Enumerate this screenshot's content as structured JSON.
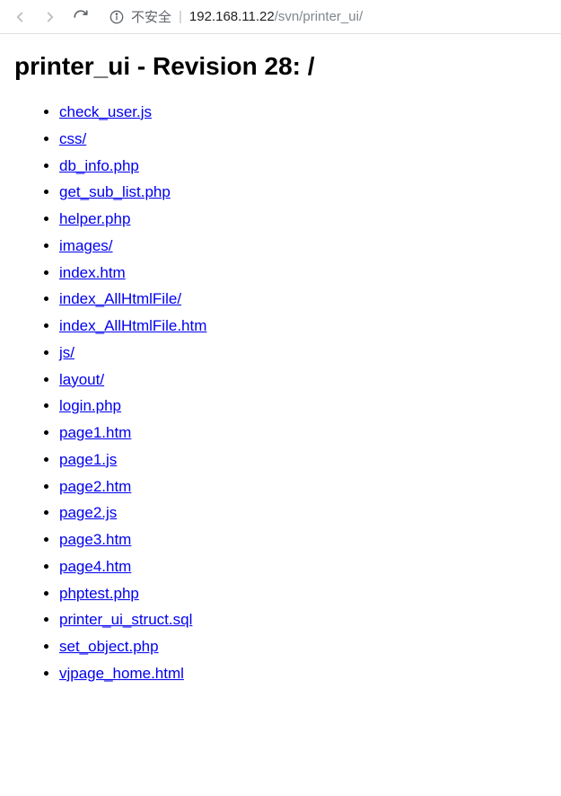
{
  "browser": {
    "security_label": "不安全",
    "url_host": "192.168.11.22",
    "url_path": "/svn/printer_ui/"
  },
  "page": {
    "title": "printer_ui - Revision 28: /",
    "files": [
      "check_user.js",
      "css/",
      "db_info.php",
      "get_sub_list.php",
      "helper.php",
      "images/",
      "index.htm",
      "index_AllHtmlFile/",
      "index_AllHtmlFile.htm",
      "js/",
      "layout/",
      "login.php",
      "page1.htm",
      "page1.js",
      "page2.htm",
      "page2.js",
      "page3.htm",
      "page4.htm",
      "phptest.php",
      "printer_ui_struct.sql",
      "set_object.php",
      "vjpage_home.html"
    ]
  }
}
